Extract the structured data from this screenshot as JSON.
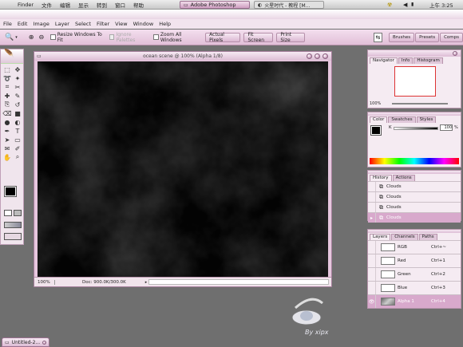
{
  "menubar": {
    "apple": "",
    "finder": "Finder",
    "items": [
      "文件",
      "编辑",
      "显示",
      "转到",
      "窗口",
      "帮助"
    ],
    "task1": "Adobe Photoshop",
    "task2": "火星时代 - 教程 [M...",
    "clock": "上午 3:25"
  },
  "app_menu": {
    "items": [
      "File",
      "Edit",
      "Image",
      "Layer",
      "Select",
      "Filter",
      "View",
      "Window",
      "Help"
    ]
  },
  "options": {
    "resize": "Resize Windows To Fit",
    "ignore": "Ignore Palettes",
    "zoom_all": "Zoom All Windows",
    "actual": "Actual Pixels",
    "fit": "Fit Screen",
    "print": "Print Size"
  },
  "palette_well": {
    "tabs": [
      "Brushes",
      "Presets",
      "Comps"
    ]
  },
  "document": {
    "title": "ocean scene @ 100% (Alpha 1/8)",
    "zoom": "100%",
    "doc_info": "Doc: 900.0K/300.0K"
  },
  "navigator": {
    "tabs": [
      "Navigator",
      "Info",
      "Histogram"
    ],
    "zoom": "100%"
  },
  "color": {
    "tabs": [
      "Color",
      "Swatches",
      "Styles"
    ],
    "channel": "K",
    "value": "100",
    "unit": "%"
  },
  "history": {
    "tabs": [
      "History",
      "Actions"
    ],
    "items": [
      "Clouds",
      "Clouds",
      "Clouds",
      "Clouds"
    ]
  },
  "layers": {
    "tabs": [
      "Layers",
      "Channels",
      "Paths"
    ],
    "channels": [
      {
        "name": "RGB",
        "key": "Ctrl+~"
      },
      {
        "name": "Red",
        "key": "Ctrl+1"
      },
      {
        "name": "Green",
        "key": "Ctrl+2"
      },
      {
        "name": "Blue",
        "key": "Ctrl+3"
      },
      {
        "name": "Alpha 1",
        "key": "Ctrl+4"
      }
    ]
  },
  "taskbar": {
    "min_window": "Untitled-2..."
  },
  "watermark": {
    "text": "By xipx"
  },
  "colors": {
    "accent": "#d9a6cb",
    "selection": "#d8a9cc"
  }
}
